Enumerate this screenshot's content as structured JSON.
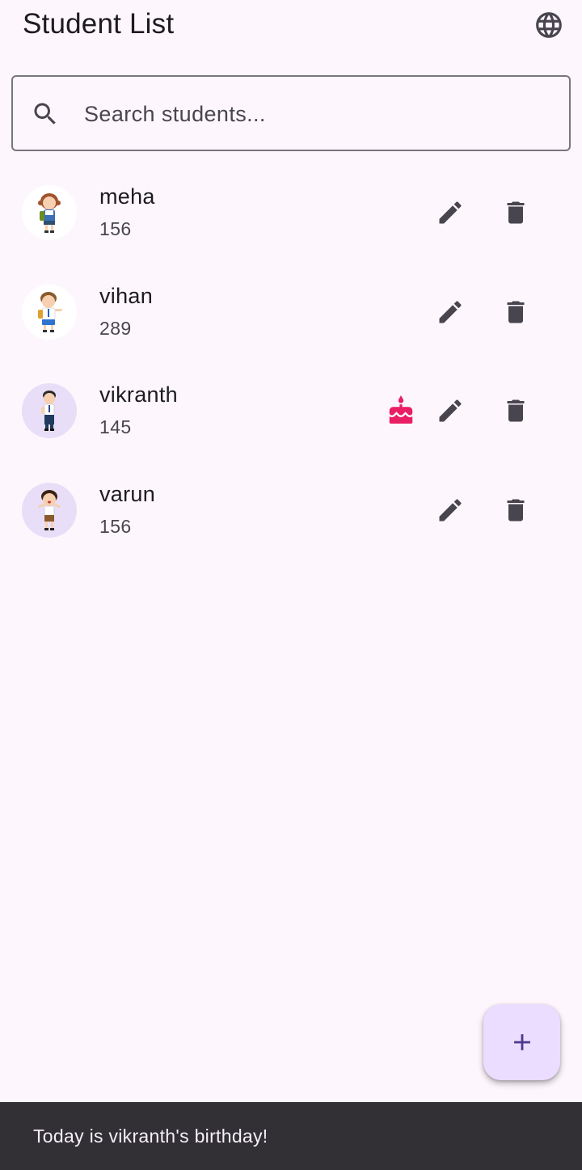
{
  "header": {
    "title": "Student List",
    "language_icon": "globe-icon"
  },
  "search": {
    "placeholder": "Search students...",
    "value": "",
    "icon": "search-icon"
  },
  "students": [
    {
      "name": "meha",
      "number": "156",
      "birthday": false
    },
    {
      "name": "vihan",
      "number": "289",
      "birthday": false
    },
    {
      "name": "vikranth",
      "number": "145",
      "birthday": true
    },
    {
      "name": "varun",
      "number": "156",
      "birthday": false
    }
  ],
  "row_icons": {
    "birthday": "cake-icon",
    "edit": "pencil-icon",
    "delete": "trash-icon"
  },
  "fab": {
    "icon": "plus-icon"
  },
  "snackbar": {
    "message": "Today is vikranth's birthday!"
  },
  "colors": {
    "background": "#fdf7fd",
    "icon": "#49454f",
    "birthday_icon": "#e91e63",
    "fab_background": "#eaddff",
    "fab_icon": "#4f378b",
    "snackbar_background": "#322f35",
    "snackbar_text": "#f5eff7",
    "avatar_lavender": "#e8def8"
  }
}
